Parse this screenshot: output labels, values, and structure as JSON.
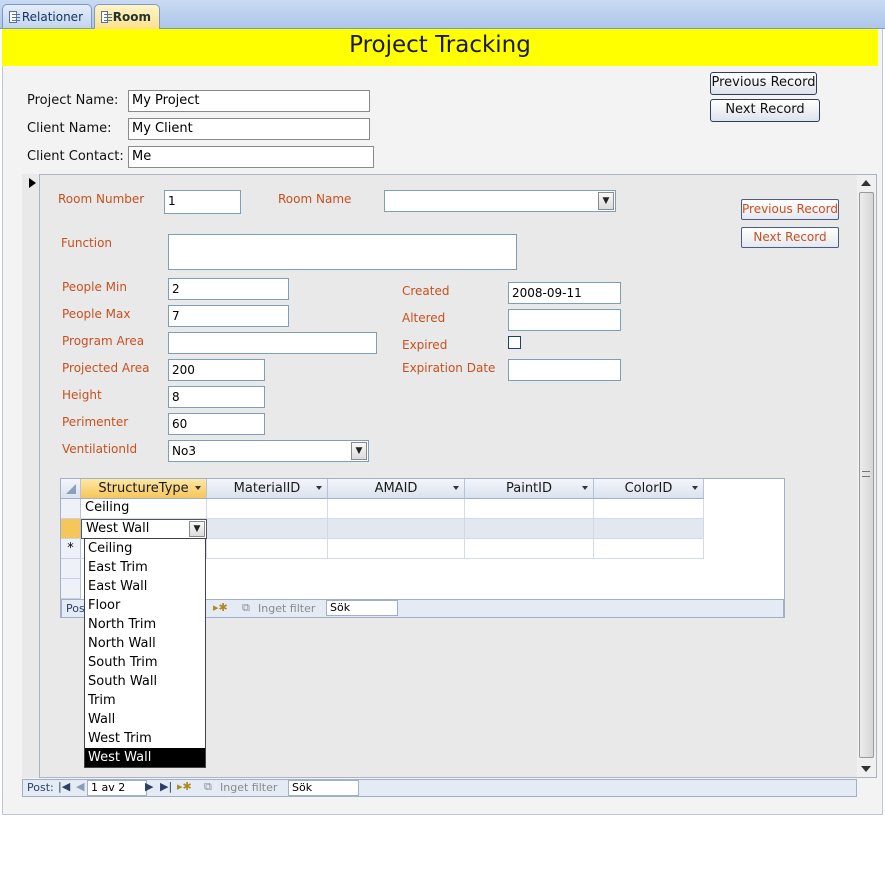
{
  "tabs": [
    {
      "label": "Relationer",
      "active": false
    },
    {
      "label": "Room",
      "active": true
    }
  ],
  "form": {
    "title": "Project Tracking",
    "title_bg": "#ffff00",
    "project_name_label": "Project Name:",
    "project_name_value": "My Project",
    "client_name_label": "Client Name:",
    "client_name_value": "My Client",
    "client_contact_label": "Client Contact:",
    "client_contact_value": "Me",
    "prev_record": "Previous Record",
    "next_record": "Next Record"
  },
  "room": {
    "accent": "#c8501e",
    "room_number_label": "Room Number",
    "room_number_value": "1",
    "room_name_label": "Room Name",
    "room_name_value": "",
    "function_label": "Function",
    "function_value": "",
    "people_min_label": "People Min",
    "people_min_value": "2",
    "people_max_label": "People Max",
    "people_max_value": "7",
    "program_area_label": "Program Area",
    "program_area_value": "",
    "projected_area_label": "Projected Area",
    "projected_area_value": "200",
    "height_label": "Height",
    "height_value": "8",
    "perimeter_label": "Perimenter",
    "perimeter_value": "60",
    "ventilation_label": "VentilationId",
    "ventilation_value": "No3",
    "created_label": "Created",
    "created_value": "2008-09-11",
    "altered_label": "Altered",
    "altered_value": "",
    "expired_label": "Expired",
    "expired_checked": false,
    "expiration_label": "Expiration Date",
    "expiration_value": "",
    "prev_record": "Previous Record",
    "next_record": "Next Record"
  },
  "structures": {
    "columns": [
      "StructureType",
      "MaterialID",
      "AMAID",
      "PaintID",
      "ColorID"
    ],
    "rows": [
      [
        "Ceiling",
        "",
        "",
        "",
        ""
      ],
      [
        "West Wall",
        "",
        "",
        "",
        ""
      ]
    ],
    "new_row_marker": "*",
    "nav_prefix": "Pos",
    "nav_filter": "Inget filter",
    "nav_search": "Sök",
    "dropdown_options": [
      "Ceiling",
      "East Trim",
      "East Wall",
      "Floor",
      "North Trim",
      "North Wall",
      "South Trim",
      "South Wall",
      "Trim",
      "Wall",
      "West Trim",
      "West Wall"
    ],
    "dropdown_selected": "West Wall"
  },
  "footer_nav": {
    "prefix": "Post:",
    "position": "1 av 2",
    "filter": "Inget filter",
    "search": "Sök"
  }
}
